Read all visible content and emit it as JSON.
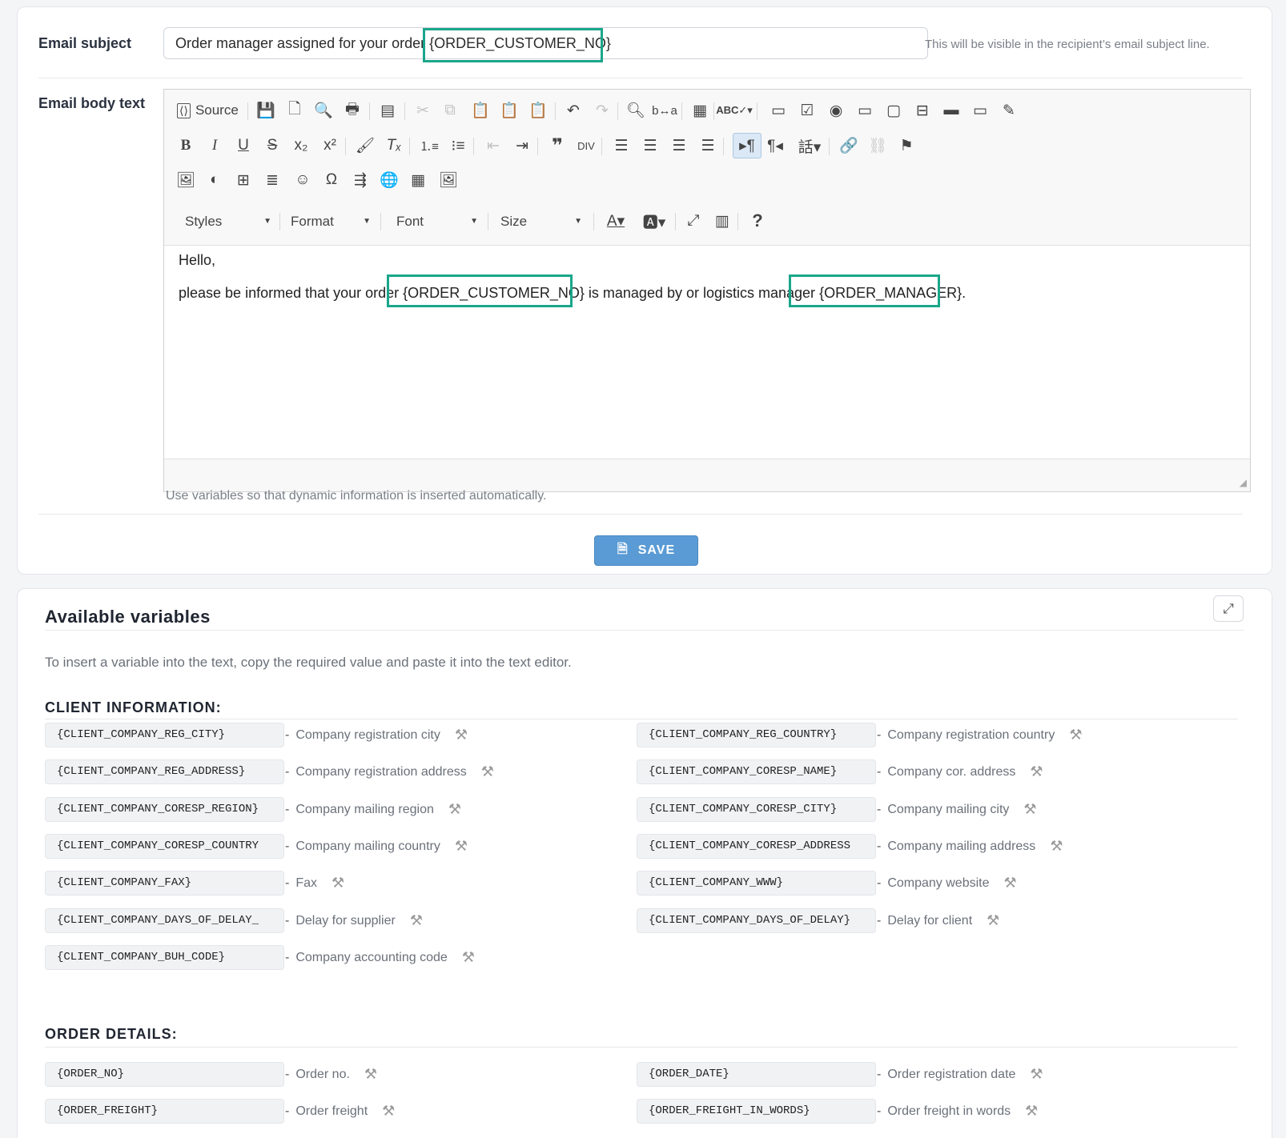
{
  "form": {
    "subject_label": "Email subject",
    "subject_value_prefix": "Order manager assigned for your order ",
    "subject_variable": "{ORDER_CUSTOMER_NO}",
    "subject_hint": "This will be visible in the recipient’s email subject line.",
    "body_label": "Email body text",
    "body_hint": "Use variables so that dynamic information is inserted automatically.",
    "save_label": "SAVE"
  },
  "editor": {
    "source_label": "Source",
    "combos": {
      "styles": "Styles",
      "format": "Format",
      "font": "Font",
      "size": "Size"
    },
    "content": {
      "line1": "Hello,",
      "line2_a": "please be informed that your order ",
      "var1": "{ORDER_CUSTOMER_NO}",
      "line2_b": " is managed by or logistics manager ",
      "var2": "{ORDER_MANAGER}",
      "line2_c": "."
    }
  },
  "variables": {
    "title": "Available variables",
    "description": "To insert a variable into the text, copy the required value and paste it into the text editor.",
    "sections": [
      {
        "title": "CLIENT INFORMATION:",
        "items": [
          {
            "code": "{CLIENT_COMPANY_REG_CITY}",
            "desc": "Company registration city"
          },
          {
            "code": "{CLIENT_COMPANY_REG_COUNTRY}",
            "desc": "Company registration country"
          },
          {
            "code": "{CLIENT_COMPANY_REG_ADDRESS}",
            "desc": "Company registration address"
          },
          {
            "code": "{CLIENT_COMPANY_CORESP_NAME}",
            "desc": "Company cor. address"
          },
          {
            "code": "{CLIENT_COMPANY_CORESP_REGION}",
            "desc": "Company mailing region"
          },
          {
            "code": "{CLIENT_COMPANY_CORESP_CITY}",
            "desc": "Company mailing city"
          },
          {
            "code": "{CLIENT_COMPANY_CORESP_COUNTRY",
            "desc": "Company mailing country"
          },
          {
            "code": "{CLIENT_COMPANY_CORESP_ADDRESS",
            "desc": "Company mailing address"
          },
          {
            "code": "{CLIENT_COMPANY_FAX}",
            "desc": "Fax"
          },
          {
            "code": "{CLIENT_COMPANY_WWW}",
            "desc": "Company website"
          },
          {
            "code": "{CLIENT_COMPANY_DAYS_OF_DELAY_",
            "desc": "Delay for supplier"
          },
          {
            "code": "{CLIENT_COMPANY_DAYS_OF_DELAY}",
            "desc": "Delay for client"
          },
          {
            "code": "{CLIENT_COMPANY_BUH_CODE}",
            "desc": "Company accounting code"
          }
        ]
      },
      {
        "title": "ORDER DETAILS:",
        "items": [
          {
            "code": "{ORDER_NO}",
            "desc": "Order no."
          },
          {
            "code": "{ORDER_DATE}",
            "desc": "Order registration date"
          },
          {
            "code": "{ORDER_FREIGHT}",
            "desc": "Order freight"
          },
          {
            "code": "{ORDER_FREIGHT_IN_WORDS}",
            "desc": "Order freight in words"
          }
        ]
      }
    ]
  },
  "colors": {
    "highlight": "#1aa68a",
    "save_button": "#5b9bd5"
  },
  "icons": {
    "source": "source-icon",
    "save": "save-icon",
    "tool": "tools-icon",
    "expand": "expand-icon"
  }
}
